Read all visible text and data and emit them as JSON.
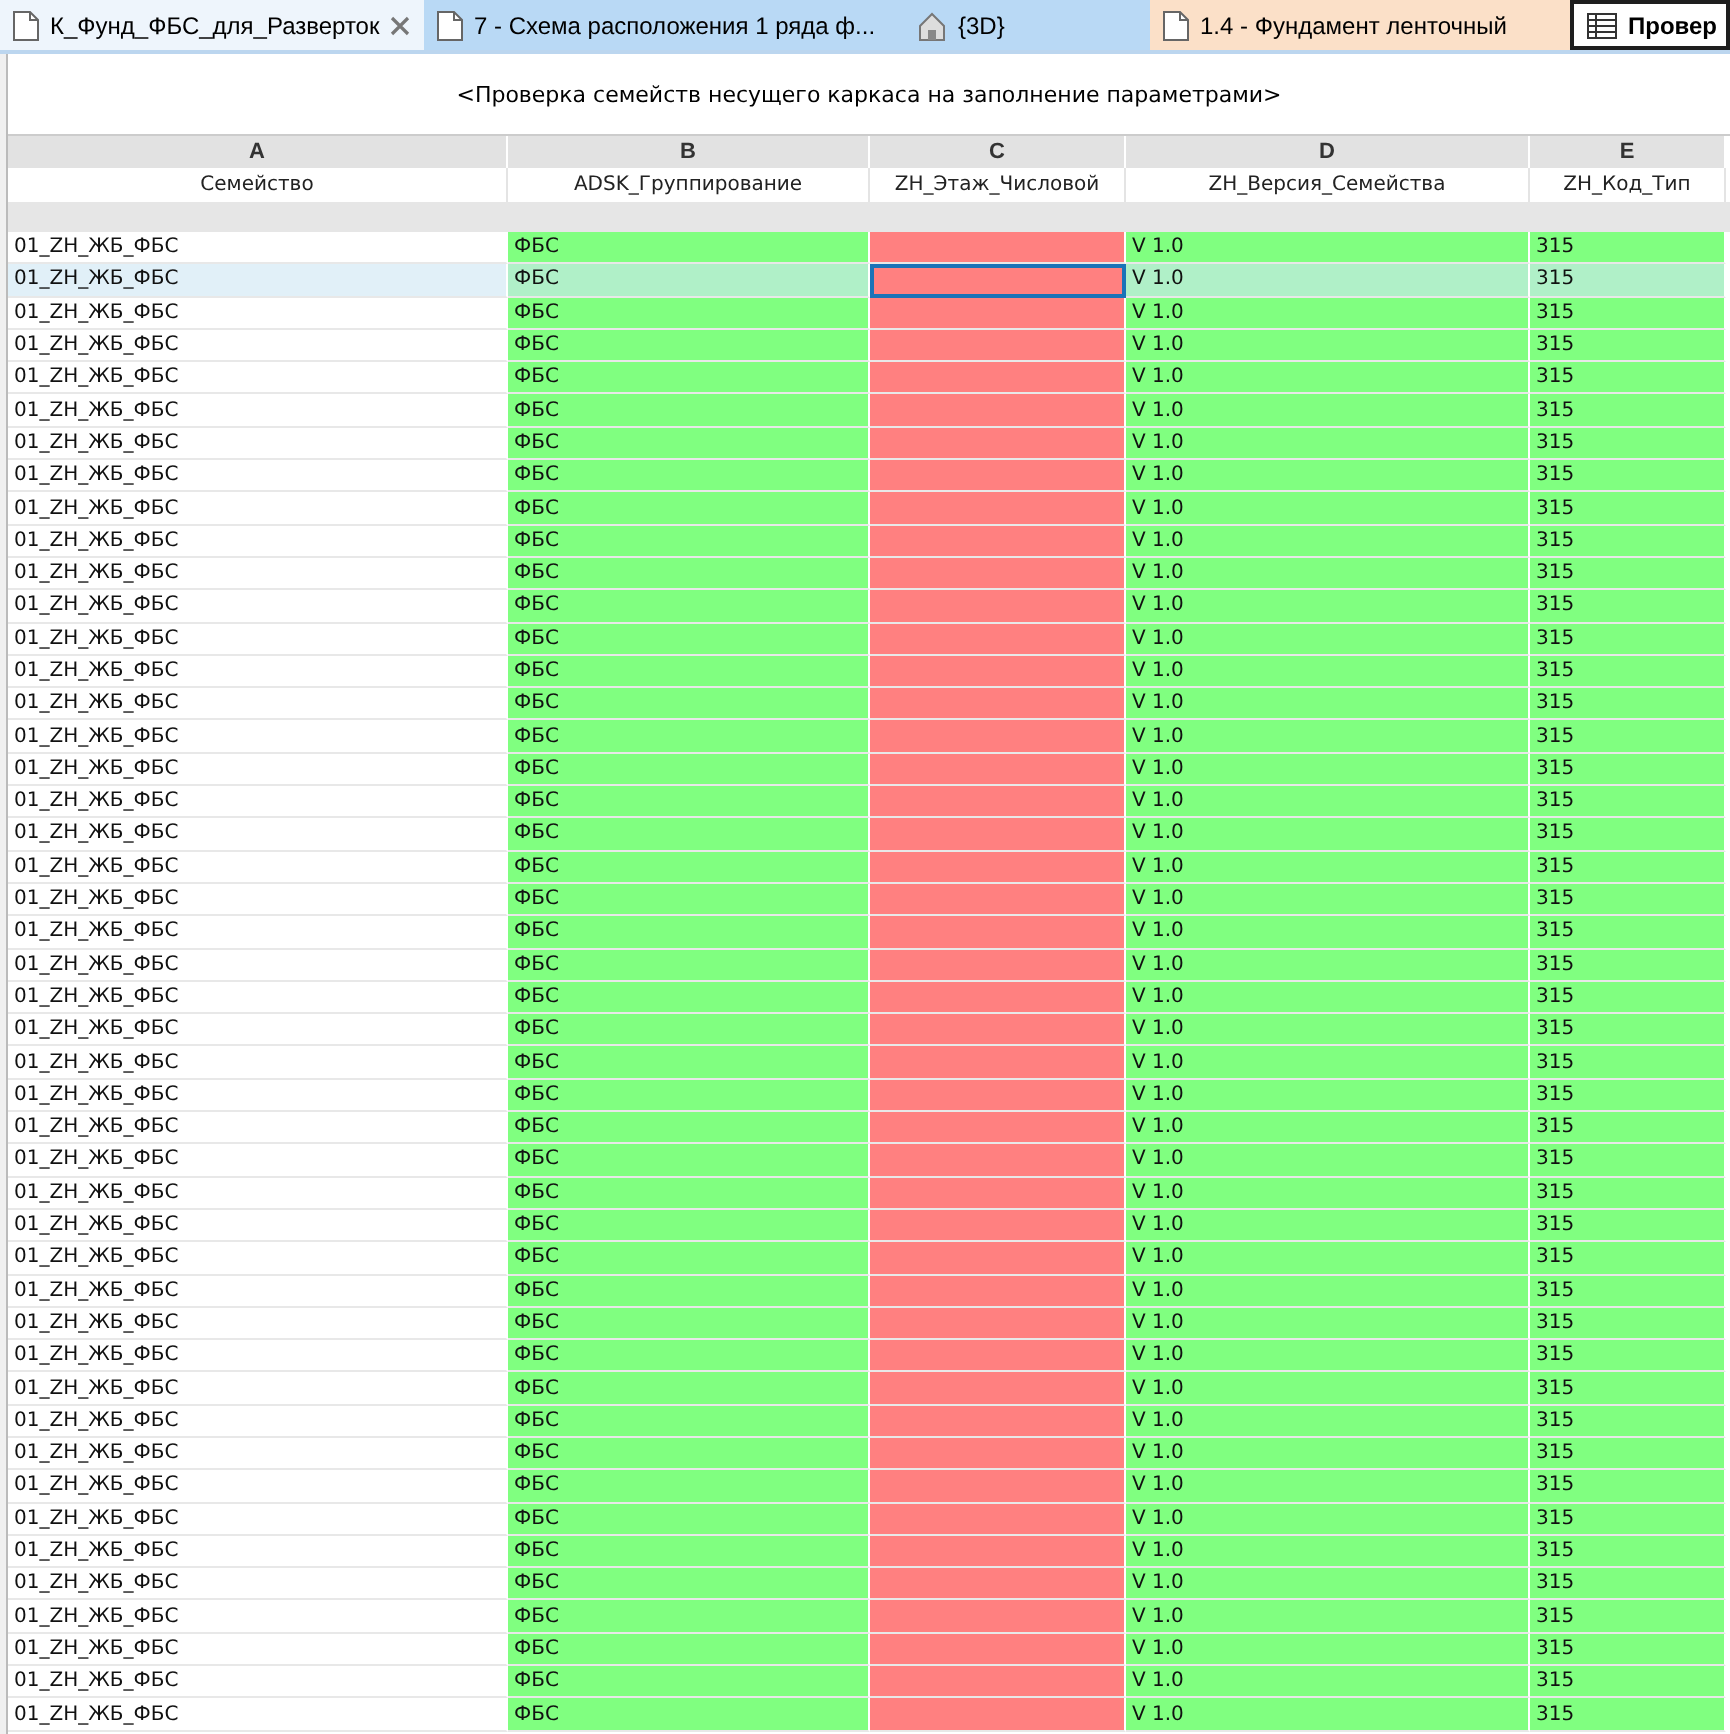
{
  "tabs": [
    {
      "label": "К_Фунд_ФБС_для_Разверток",
      "kind": "sheet",
      "selected": false,
      "closable": true
    },
    {
      "label": "7 - Схема расположения 1 ряда ф...",
      "kind": "sheet",
      "selected": false,
      "closable": false
    },
    {
      "label": "{3D}",
      "kind": "view",
      "selected": false,
      "closable": false
    },
    {
      "label": "1.4 - Фундамент ленточный",
      "kind": "plan",
      "selected": false,
      "closable": false
    },
    {
      "label": "Провер",
      "kind": "schedule",
      "selected": true,
      "closable": false
    }
  ],
  "schedule": {
    "title": "<Проверка семейств несущего каркаса на заполнение параметрами>",
    "columns": [
      {
        "letter": "A",
        "name": "Семейство",
        "color": "#ffffff"
      },
      {
        "letter": "B",
        "name": "ADSK_Группирование",
        "color": "#80ff80"
      },
      {
        "letter": "C",
        "name": "ZH_Этаж_Числовой",
        "color": "#ff8080"
      },
      {
        "letter": "D",
        "name": "ZH_Версия_Семейства",
        "color": "#80ff80"
      },
      {
        "letter": "E",
        "name": "ZH_Код_Тип",
        "color": "#80ff80"
      }
    ],
    "rows": [
      {
        "cells": [
          "01_ZH_ЖБ_ФБС",
          "ФБС",
          "",
          "V 1.0",
          "315"
        ],
        "selected": false
      },
      {
        "cells": [
          "01_ZH_ЖБ_ФБС",
          "ФБС",
          "",
          "V 1.0",
          "315"
        ],
        "selected": true
      },
      {
        "cells": [
          "01_ZH_ЖБ_ФБС",
          "ФБС",
          "",
          "V 1.0",
          "315"
        ],
        "selected": false
      },
      {
        "cells": [
          "01_ZH_ЖБ_ФБС",
          "ФБС",
          "",
          "V 1.0",
          "315"
        ],
        "selected": false
      },
      {
        "cells": [
          "01_ZH_ЖБ_ФБС",
          "ФБС",
          "",
          "V 1.0",
          "315"
        ],
        "selected": false
      },
      {
        "cells": [
          "01_ZH_ЖБ_ФБС",
          "ФБС",
          "",
          "V 1.0",
          "315"
        ],
        "selected": false
      },
      {
        "cells": [
          "01_ZH_ЖБ_ФБС",
          "ФБС",
          "",
          "V 1.0",
          "315"
        ],
        "selected": false
      },
      {
        "cells": [
          "01_ZH_ЖБ_ФБС",
          "ФБС",
          "",
          "V 1.0",
          "315"
        ],
        "selected": false
      },
      {
        "cells": [
          "01_ZH_ЖБ_ФБС",
          "ФБС",
          "",
          "V 1.0",
          "315"
        ],
        "selected": false
      },
      {
        "cells": [
          "01_ZH_ЖБ_ФБС",
          "ФБС",
          "",
          "V 1.0",
          "315"
        ],
        "selected": false
      },
      {
        "cells": [
          "01_ZH_ЖБ_ФБС",
          "ФБС",
          "",
          "V 1.0",
          "315"
        ],
        "selected": false
      },
      {
        "cells": [
          "01_ZH_ЖБ_ФБС",
          "ФБС",
          "",
          "V 1.0",
          "315"
        ],
        "selected": false
      },
      {
        "cells": [
          "01_ZH_ЖБ_ФБС",
          "ФБС",
          "",
          "V 1.0",
          "315"
        ],
        "selected": false
      },
      {
        "cells": [
          "01_ZH_ЖБ_ФБС",
          "ФБС",
          "",
          "V 1.0",
          "315"
        ],
        "selected": false
      },
      {
        "cells": [
          "01_ZH_ЖБ_ФБС",
          "ФБС",
          "",
          "V 1.0",
          "315"
        ],
        "selected": false
      },
      {
        "cells": [
          "01_ZH_ЖБ_ФБС",
          "ФБС",
          "",
          "V 1.0",
          "315"
        ],
        "selected": false
      },
      {
        "cells": [
          "01_ZH_ЖБ_ФБС",
          "ФБС",
          "",
          "V 1.0",
          "315"
        ],
        "selected": false
      },
      {
        "cells": [
          "01_ZH_ЖБ_ФБС",
          "ФБС",
          "",
          "V 1.0",
          "315"
        ],
        "selected": false
      },
      {
        "cells": [
          "01_ZH_ЖБ_ФБС",
          "ФБС",
          "",
          "V 1.0",
          "315"
        ],
        "selected": false
      },
      {
        "cells": [
          "01_ZH_ЖБ_ФБС",
          "ФБС",
          "",
          "V 1.0",
          "315"
        ],
        "selected": false
      },
      {
        "cells": [
          "01_ZH_ЖБ_ФБС",
          "ФБС",
          "",
          "V 1.0",
          "315"
        ],
        "selected": false
      },
      {
        "cells": [
          "01_ZH_ЖБ_ФБС",
          "ФБС",
          "",
          "V 1.0",
          "315"
        ],
        "selected": false
      },
      {
        "cells": [
          "01_ZH_ЖБ_ФБС",
          "ФБС",
          "",
          "V 1.0",
          "315"
        ],
        "selected": false
      },
      {
        "cells": [
          "01_ZH_ЖБ_ФБС",
          "ФБС",
          "",
          "V 1.0",
          "315"
        ],
        "selected": false
      },
      {
        "cells": [
          "01_ZH_ЖБ_ФБС",
          "ФБС",
          "",
          "V 1.0",
          "315"
        ],
        "selected": false
      },
      {
        "cells": [
          "01_ZH_ЖБ_ФБС",
          "ФБС",
          "",
          "V 1.0",
          "315"
        ],
        "selected": false
      },
      {
        "cells": [
          "01_ZH_ЖБ_ФБС",
          "ФБС",
          "",
          "V 1.0",
          "315"
        ],
        "selected": false
      },
      {
        "cells": [
          "01_ZH_ЖБ_ФБС",
          "ФБС",
          "",
          "V 1.0",
          "315"
        ],
        "selected": false
      },
      {
        "cells": [
          "01_ZH_ЖБ_ФБС",
          "ФБС",
          "",
          "V 1.0",
          "315"
        ],
        "selected": false
      },
      {
        "cells": [
          "01_ZH_ЖБ_ФБС",
          "ФБС",
          "",
          "V 1.0",
          "315"
        ],
        "selected": false
      },
      {
        "cells": [
          "01_ZH_ЖБ_ФБС",
          "ФБС",
          "",
          "V 1.0",
          "315"
        ],
        "selected": false
      },
      {
        "cells": [
          "01_ZH_ЖБ_ФБС",
          "ФБС",
          "",
          "V 1.0",
          "315"
        ],
        "selected": false
      },
      {
        "cells": [
          "01_ZH_ЖБ_ФБС",
          "ФБС",
          "",
          "V 1.0",
          "315"
        ],
        "selected": false
      },
      {
        "cells": [
          "01_ZH_ЖБ_ФБС",
          "ФБС",
          "",
          "V 1.0",
          "315"
        ],
        "selected": false
      },
      {
        "cells": [
          "01_ZH_ЖБ_ФБС",
          "ФБС",
          "",
          "V 1.0",
          "315"
        ],
        "selected": false
      },
      {
        "cells": [
          "01_ZH_ЖБ_ФБС",
          "ФБС",
          "",
          "V 1.0",
          "315"
        ],
        "selected": false
      },
      {
        "cells": [
          "01_ZH_ЖБ_ФБС",
          "ФБС",
          "",
          "V 1.0",
          "315"
        ],
        "selected": false
      },
      {
        "cells": [
          "01_ZH_ЖБ_ФБС",
          "ФБС",
          "",
          "V 1.0",
          "315"
        ],
        "selected": false
      },
      {
        "cells": [
          "01_ZH_ЖБ_ФБС",
          "ФБС",
          "",
          "V 1.0",
          "315"
        ],
        "selected": false
      },
      {
        "cells": [
          "01_ZH_ЖБ_ФБС",
          "ФБС",
          "",
          "V 1.0",
          "315"
        ],
        "selected": false
      },
      {
        "cells": [
          "01_ZH_ЖБ_ФБС",
          "ФБС",
          "",
          "V 1.0",
          "315"
        ],
        "selected": false
      },
      {
        "cells": [
          "01_ZH_ЖБ_ФБС",
          "ФБС",
          "",
          "V 1.0",
          "315"
        ],
        "selected": false
      },
      {
        "cells": [
          "01_ZH_ЖБ_ФБС",
          "ФБС",
          "",
          "V 1.0",
          "315"
        ],
        "selected": false
      },
      {
        "cells": [
          "01_ZH_ЖБ_ФБС",
          "ФБС",
          "",
          "V 1.0",
          "315"
        ],
        "selected": false
      },
      {
        "cells": [
          "01_ZH_ЖБ_ФБС",
          "ФБС",
          "",
          "V 1.0",
          "315"
        ],
        "selected": false
      },
      {
        "cells": [
          "01_ZH_ЖБ_ФБС",
          "ФБС",
          "",
          "V 1.0",
          "315"
        ],
        "selected": false
      }
    ]
  }
}
